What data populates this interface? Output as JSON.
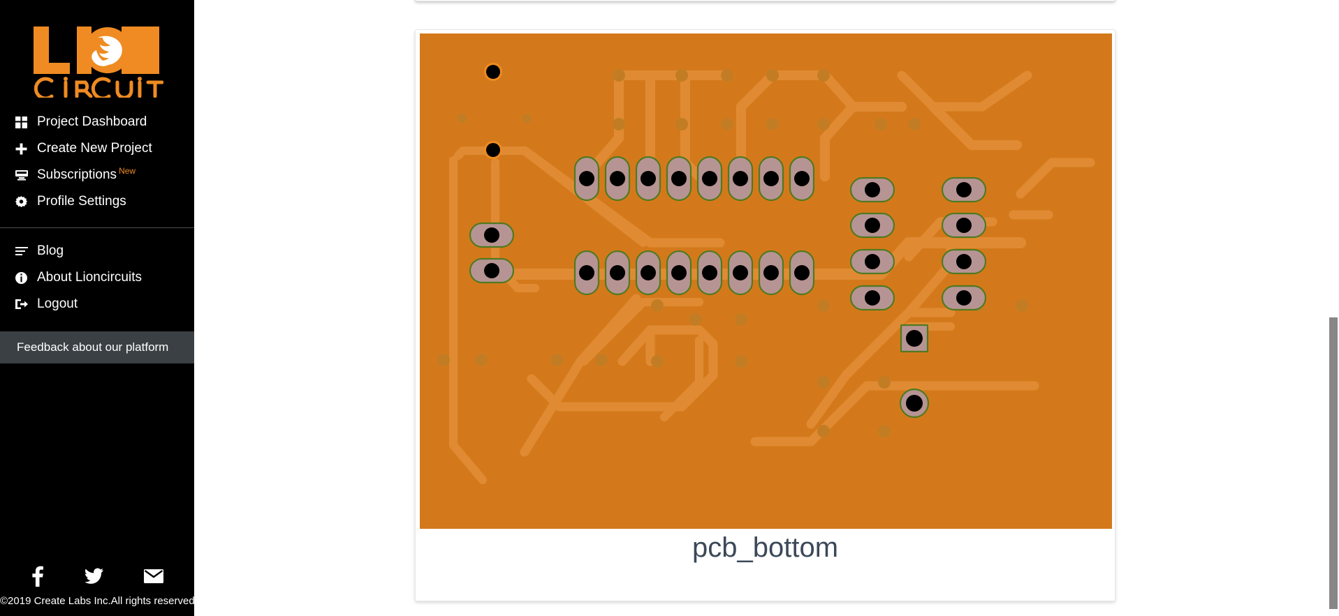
{
  "sidebar": {
    "logo": {
      "line1": "LION",
      "line2": "CIRCUITS",
      "color": "#ef8b22"
    },
    "primary_items": [
      {
        "label": "Project Dashboard",
        "icon": "grid-icon"
      },
      {
        "label": "Create New Project",
        "icon": "plus-icon"
      },
      {
        "label": "Subscriptions",
        "icon": "monitor-icon",
        "badge": "New"
      },
      {
        "label": "Profile Settings",
        "icon": "gear-icon"
      }
    ],
    "secondary_items": [
      {
        "label": "Blog",
        "icon": "lines-icon"
      },
      {
        "label": "About Lioncircuits",
        "icon": "info-circle-icon"
      },
      {
        "label": "Logout",
        "icon": "logout-icon"
      }
    ],
    "feedback_label": "Feedback about our platform",
    "social": [
      {
        "name": "facebook-icon",
        "label": "f"
      },
      {
        "name": "twitter-icon",
        "label": "t"
      },
      {
        "name": "email-icon",
        "label": "e"
      }
    ],
    "copyright": "©2019 Create Labs Inc.All rights reserved."
  },
  "main": {
    "pcb_caption": "pcb_bottom",
    "colors": {
      "board": "#d4791b",
      "trace": "#e08b33",
      "pad_fill": "#b79494",
      "pad_outline": "#4f7a1f",
      "drill": "#000000",
      "via": "#c17e25",
      "hole_ring": "#ef8b22"
    }
  }
}
